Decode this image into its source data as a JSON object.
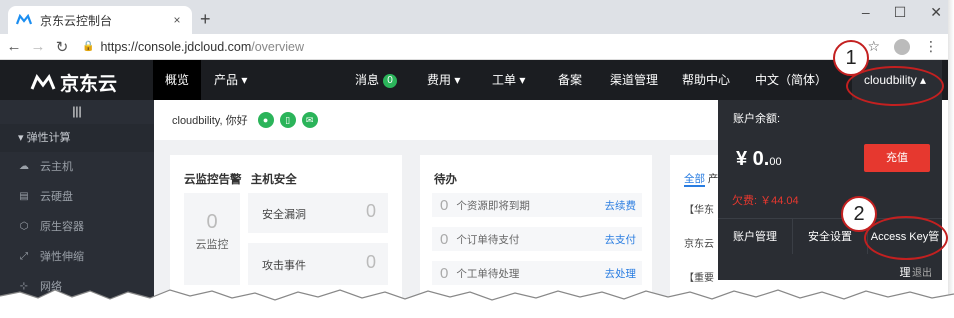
{
  "browser": {
    "tab_title": "京东云控制台",
    "tab_close": "×",
    "new_tab": "+",
    "url_host": "https://console.jdcloud.com",
    "url_path": "/overview",
    "win_min": "–",
    "win_max": "☐",
    "win_close": "✕"
  },
  "topnav": {
    "logo_text": "京东云",
    "items": [
      "概览",
      "产品 ▾",
      "消息",
      "费用 ▾",
      "工单 ▾",
      "备案",
      "渠道管理",
      "帮助中心",
      "中文（简体）"
    ],
    "message_count": "0",
    "user": "cloudbility ▴"
  },
  "sidebar": {
    "toggle": "|||",
    "section": "▾  弹性计算",
    "items": [
      "云主机",
      "云硬盘",
      "原生容器",
      "弹性伸缩",
      "网络"
    ]
  },
  "main": {
    "greeting": "cloudbility, 你好",
    "monitor": {
      "title1": "云监控告警",
      "title2": "主机安全",
      "count": "0",
      "label": "云监控",
      "rows": [
        {
          "label": "安全漏洞",
          "value": "0"
        },
        {
          "label": "攻击事件",
          "value": "0"
        }
      ]
    },
    "todo": {
      "title": "待办",
      "rows": [
        {
          "num": "0",
          "text": "个资源即将到期",
          "link": "去续费"
        },
        {
          "num": "0",
          "text": "个订单待支付",
          "link": "去支付"
        },
        {
          "num": "0",
          "text": "个工单待处理",
          "link": "去处理"
        }
      ]
    },
    "news": {
      "tab_all": "全部",
      "tab_product": "产",
      "rows": [
        "【华东",
        "京东云",
        "【重要"
      ]
    }
  },
  "account": {
    "balance_label": "账户余额:",
    "balance_main": "¥ 0.",
    "balance_cents": "00",
    "recharge": "充值",
    "arrears": "欠费: ￥44.04",
    "actions": [
      "账户管理",
      "安全设置",
      "Access Key管理"
    ],
    "logout": "退出"
  },
  "callouts": [
    "1",
    "2"
  ],
  "colors": {
    "nav_bg": "#1b1d21",
    "sidebar_bg": "#2a2e36",
    "accent_red": "#e6382f",
    "link_blue": "#2a7de1",
    "success_green": "#2bb45a"
  }
}
